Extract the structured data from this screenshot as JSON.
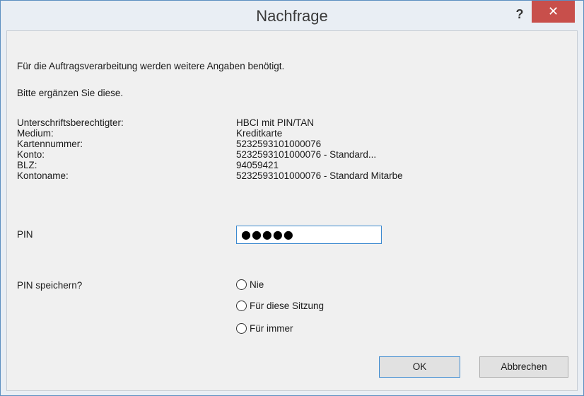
{
  "dialog": {
    "title": "Nachfrage",
    "help_label": "?",
    "close_label": "✕"
  },
  "intro": {
    "line1": "Für die Auftragsverarbeitung werden weitere Angaben benötigt.",
    "line2": "Bitte ergänzen Sie diese."
  },
  "details": {
    "labels": [
      "Unterschriftsberechtigter:",
      "Medium:",
      "Kartennummer:",
      "Konto:",
      "BLZ:",
      "Kontoname:"
    ],
    "values": [
      "HBCI mit PIN/TAN",
      "Kreditkarte",
      "5232593101000076",
      "5232593101000076 - Standard...",
      "94059421",
      "5232593101000076 - Standard Mitarbe"
    ]
  },
  "pin": {
    "label": "PIN",
    "value": "●●●●●"
  },
  "save_pin": {
    "label": "PIN speichern?",
    "options": [
      "Nie",
      "Für diese Sitzung",
      "Für immer"
    ],
    "selected": null
  },
  "buttons": {
    "ok": "OK",
    "cancel": "Abbrechen"
  }
}
